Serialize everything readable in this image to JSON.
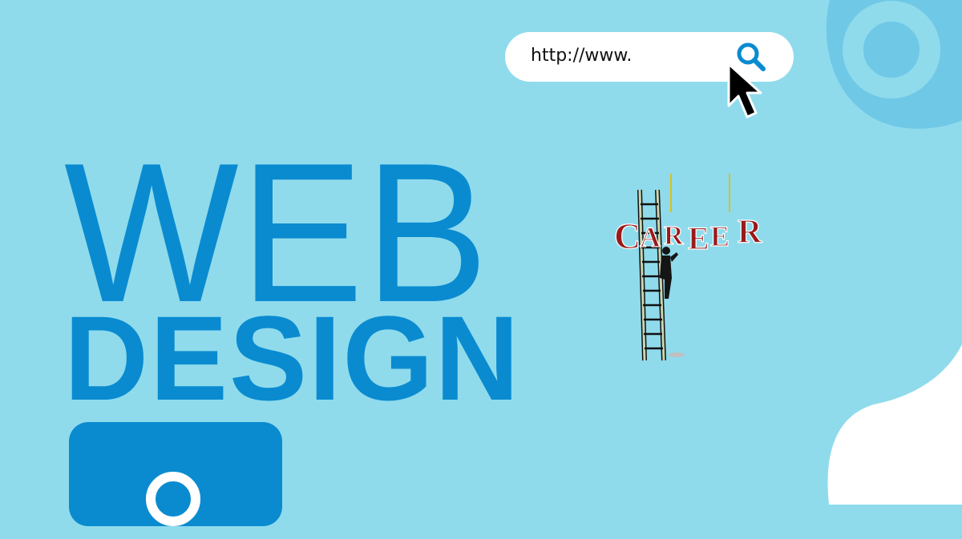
{
  "url_bar": {
    "text": "http://www.",
    "icon": "search-icon"
  },
  "title": {
    "line1": "WEB",
    "line2": "DESIGN"
  },
  "illustration": {
    "sign_text": "CAREER",
    "description_icons": [
      "ladder-icon",
      "climber-icon",
      "career-sign"
    ]
  },
  "search_card": {
    "icon": "search-icon"
  },
  "colors": {
    "background": "#8fdbec",
    "brand_blue": "#0a8bd0",
    "blob_blue": "#6fc8e6",
    "sign_red": "#9a1a1a",
    "white": "#ffffff"
  }
}
